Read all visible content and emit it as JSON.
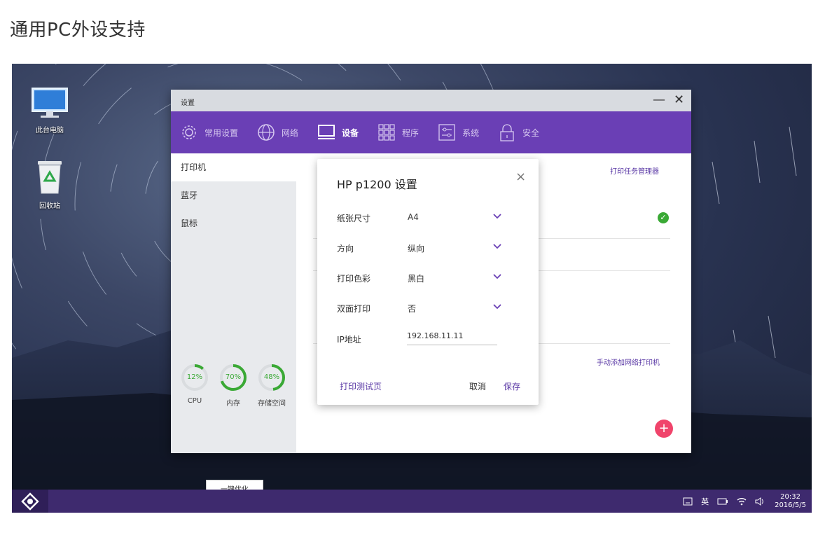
{
  "page": {
    "title": "通用PC外设支持"
  },
  "desktop": {
    "icons": [
      {
        "label": "此台电脑",
        "icon": "monitor-icon"
      },
      {
        "label": "回收站",
        "icon": "recycle-bin-icon"
      }
    ]
  },
  "window": {
    "title": "设置",
    "minimize_label": "—",
    "close_label": "✕",
    "nav": [
      {
        "label": "常用设置",
        "icon": "gear-icon",
        "active": false
      },
      {
        "label": "网络",
        "icon": "globe-icon",
        "active": false
      },
      {
        "label": "设备",
        "icon": "monitor-icon",
        "active": true
      },
      {
        "label": "程序",
        "icon": "grid-icon",
        "active": false
      },
      {
        "label": "系统",
        "icon": "sliders-icon",
        "active": false
      },
      {
        "label": "安全",
        "icon": "lock-icon",
        "active": false
      }
    ],
    "sidebar": {
      "items": [
        {
          "label": "打印机",
          "active": true
        },
        {
          "label": "蓝牙",
          "active": false
        },
        {
          "label": "鼠标",
          "active": false
        }
      ],
      "gauges": [
        {
          "label": "CPU",
          "value": "12%",
          "percent": 12
        },
        {
          "label": "内存",
          "value": "70%",
          "percent": 70
        },
        {
          "label": "存储空间",
          "value": "48%",
          "percent": 48
        }
      ],
      "optimize_label": "一键优化"
    },
    "main": {
      "print_manager_link": "打印任务管理器",
      "add_network_printer_link": "手动添加网络打印机",
      "add_button": "+",
      "check_glyph": "✓"
    }
  },
  "dialog": {
    "title": "HP p1200 设置",
    "close_label": "×",
    "rows": [
      {
        "key": "纸张尺寸",
        "value": "A4"
      },
      {
        "key": "方向",
        "value": "纵向"
      },
      {
        "key": "打印色彩",
        "value": "黑白"
      },
      {
        "key": "双面打印",
        "value": "否"
      }
    ],
    "ip_label": "IP地址",
    "ip_value": "192.168.11.11",
    "test_page": "打印测试页",
    "cancel": "取消",
    "save": "保存"
  },
  "taskbar": {
    "ime": "英",
    "time": "20:32",
    "date": "2016/5/5"
  },
  "colors": {
    "accent": "#6a3fb5",
    "link": "#5b3aa6",
    "gauge": "#3aa935",
    "fab": "#f0446b",
    "taskbar": "#3e2a6e"
  }
}
